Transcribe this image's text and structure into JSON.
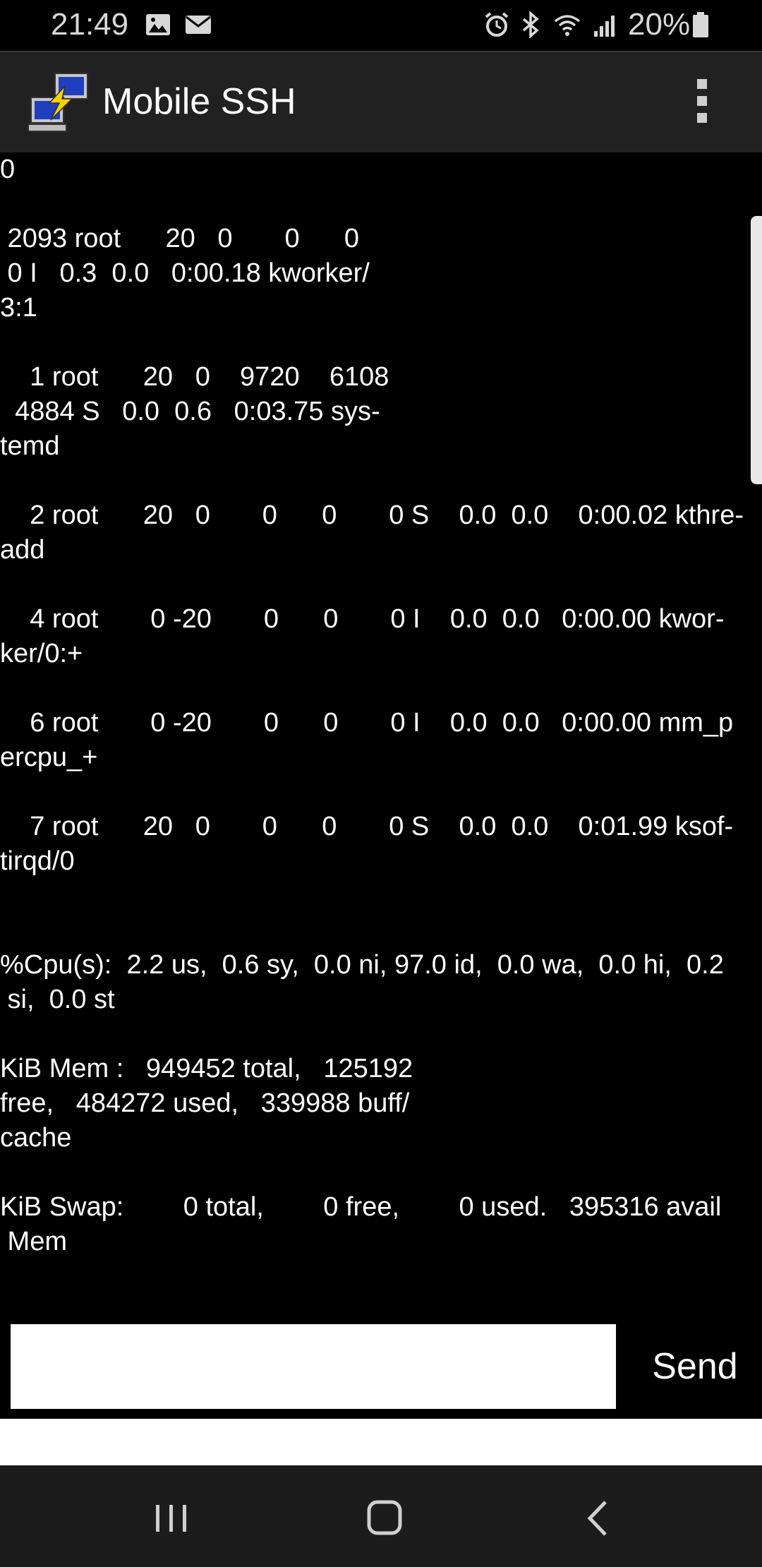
{
  "status_bar": {
    "time": "21:49",
    "battery": "20%",
    "left_icons": [
      "image-icon",
      "mail-icon"
    ],
    "right_icons": [
      "alarm-icon",
      "bluetooth-icon",
      "wifi-icon",
      "signal-icon",
      "battery-icon"
    ]
  },
  "app_bar": {
    "title": "Mobile SSH",
    "logo_icon": "computer-network-icon",
    "menu_icon": "overflow-menu-icon"
  },
  "terminal": {
    "lines": [
      "0",
      "",
      " 2093 root      20   0       0      0",
      " 0 I   0.3  0.0   0:00.18 kworker/",
      "3:1",
      "",
      "    1 root      20   0    9720    6108",
      "  4884 S   0.0  0.6   0:03.75 sys-",
      "temd",
      "",
      "    2 root      20   0       0      0       0 S    0.0  0.0    0:00.02 kthre-",
      "add",
      "",
      "    4 root       0 -20       0      0       0 I    0.0  0.0   0:00.00 kwor-",
      "ker/0:+",
      "",
      "    6 root       0 -20       0      0       0 I    0.0  0.0   0:00.00 mm_p",
      "ercpu_+",
      "",
      "    7 root      20   0       0      0       0 S    0.0  0.0    0:01.99 ksof-",
      "tirqd/0",
      "",
      "",
      "%Cpu(s):  2.2 us,  0.6 sy,  0.0 ni, 97.0 id,  0.0 wa,  0.0 hi,  0.2",
      " si,  0.0 st",
      "",
      "KiB Mem :   949452 total,   125192",
      "free,   484272 used,   339988 buff/",
      "cache",
      "",
      "KiB Swap:        0 total,        0 free,        0 used.   395316 avail",
      " Mem"
    ]
  },
  "input": {
    "value": "",
    "send_label": "Send"
  },
  "nav_bar": {
    "recents_icon": "recents-icon",
    "home_icon": "home-icon",
    "back_icon": "back-icon"
  }
}
